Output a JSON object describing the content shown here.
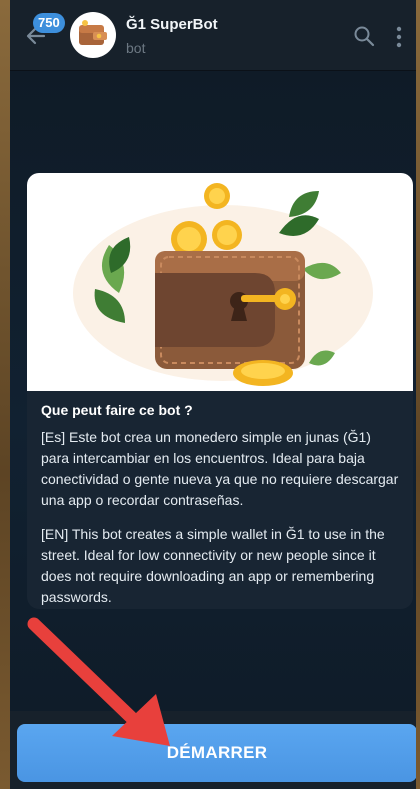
{
  "header": {
    "unread_count": "750",
    "title": "Ğ1 SuperBot",
    "subtitle": "bot"
  },
  "card": {
    "heading": "Que peut faire ce bot ?",
    "text_es": "[Es] Este bot crea un monedero simple en junas (Ğ1) para intercambiar en los encuentros. Ideal para baja conectividad o gente nueva ya que no requiere descargar una app o recordar contraseñas.",
    "text_en": "[EN] This bot creates a simple wallet in Ğ1 to use in the street. Ideal for low connectivity or new people since it does not require downloading an app or remembering passwords."
  },
  "bottom": {
    "start_label": "DÉMARRER"
  },
  "colors": {
    "accent": "#4a95e3",
    "badge": "#3d8fdc",
    "annotation_arrow": "#e8403c"
  },
  "icons": [
    "back-arrow-icon",
    "search-icon",
    "more-vert-icon",
    "wallet-avatar",
    "wallet-illustration"
  ]
}
